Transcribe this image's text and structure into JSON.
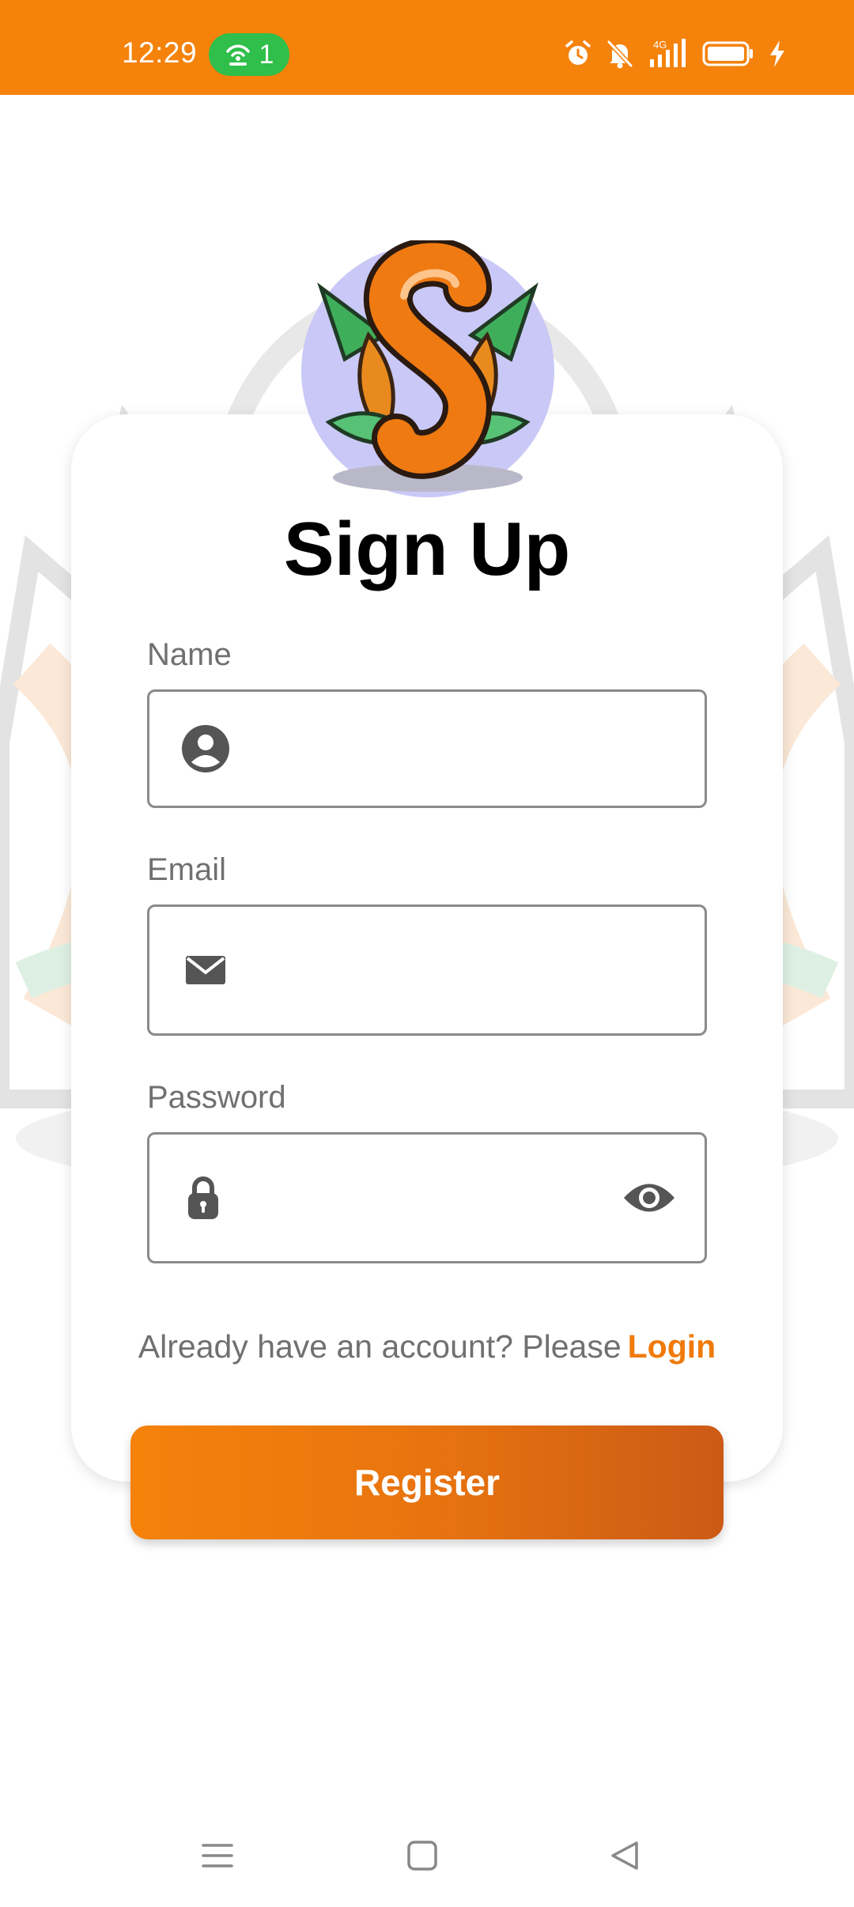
{
  "status_bar": {
    "time": "12:29",
    "hotspot_count": "1",
    "network_label": "4G",
    "icons": [
      "hotspot-icon",
      "alarm-icon",
      "muted-bell-icon",
      "signal-icon",
      "battery-icon",
      "charging-icon"
    ]
  },
  "page": {
    "title": "Sign Up"
  },
  "form": {
    "name_label": "Name",
    "name_value": "",
    "email_label": "Email",
    "email_value": "",
    "password_label": "Password",
    "password_value": ""
  },
  "login_prompt": {
    "text": "Already have an account? Please",
    "link": "Login"
  },
  "register_button": "Register",
  "colors": {
    "brand_orange": "#f5820b",
    "link_orange": "#f07a0a",
    "hotspot_green": "#2fbf4a"
  },
  "nav_bar": {
    "icons": [
      "menu-icon",
      "home-icon",
      "back-icon"
    ]
  }
}
